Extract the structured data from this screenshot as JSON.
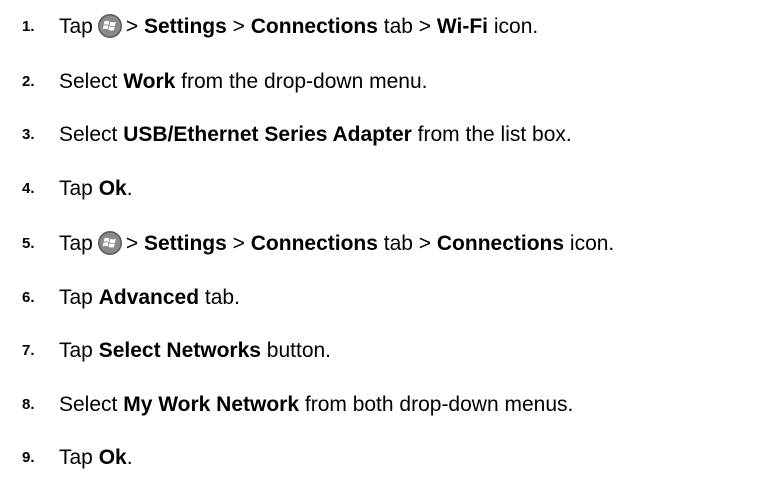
{
  "steps": [
    {
      "number": "1.",
      "parts": [
        "Tap",
        "",
        "> ",
        "Settings",
        " > ",
        "Connections",
        " tab > ",
        "Wi-Fi",
        " icon."
      ]
    },
    {
      "number": "2.",
      "parts": [
        "Select ",
        "Work",
        " from the drop-down menu."
      ]
    },
    {
      "number": "3.",
      "parts": [
        "Select ",
        "USB/Ethernet Series Adapter",
        " from the list box."
      ]
    },
    {
      "number": "4.",
      "parts": [
        "Tap ",
        "Ok",
        "."
      ]
    },
    {
      "number": "5.",
      "parts": [
        "Tap",
        "",
        "> ",
        "Settings",
        " > ",
        "Connections",
        " tab > ",
        "Connections",
        " icon."
      ]
    },
    {
      "number": "6.",
      "parts": [
        "Tap ",
        "Advanced",
        " tab."
      ]
    },
    {
      "number": "7.",
      "parts": [
        "Tap ",
        "Select Networks",
        " button."
      ]
    },
    {
      "number": "8.",
      "parts": [
        "Select ",
        "My Work Network",
        " from both drop-down menus."
      ]
    },
    {
      "number": "9.",
      "parts": [
        "Tap ",
        "Ok",
        "."
      ]
    }
  ],
  "icons": {
    "start": "windows-start-icon"
  },
  "colors": {
    "text": "#000000",
    "start_icon_outer": "#5a5a5a",
    "start_icon_inner": "#ffffff"
  }
}
